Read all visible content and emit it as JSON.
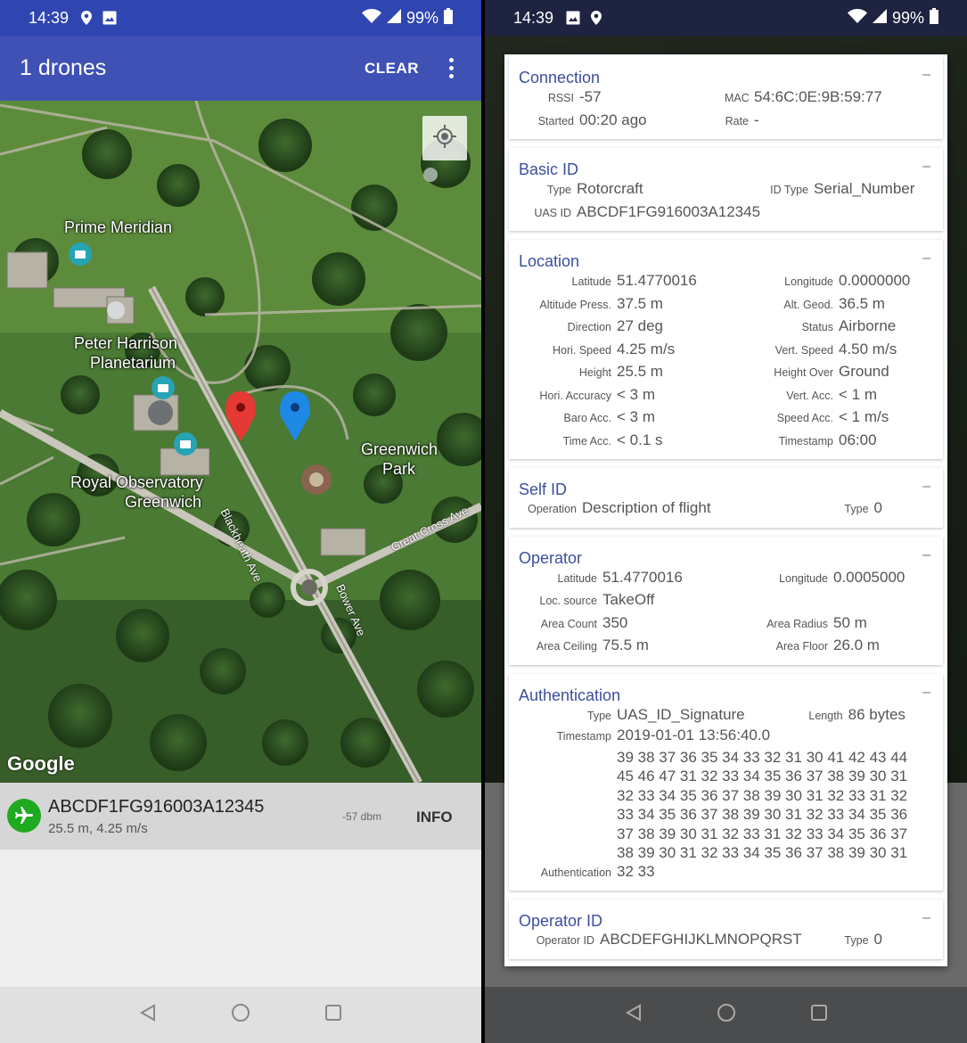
{
  "left": {
    "status": {
      "time": "14:39",
      "battery": "99%"
    },
    "appbar": {
      "title": "1 drones",
      "clear": "CLEAR"
    },
    "map": {
      "labels": {
        "prime_meridian": "Prime Meridian",
        "planetarium_1": "Peter Harrison",
        "planetarium_2": "Planetarium",
        "observatory_1": "Royal Observatory",
        "observatory_2": "Greenwich",
        "park_1": "Greenwich",
        "park_2": "Park",
        "blackheath": "Blackheath Ave",
        "bower": "Bower Ave",
        "great_cross": "Great Cross Ave"
      },
      "google": "Google"
    },
    "drone": {
      "id": "ABCDF1FG916003A12345",
      "sub": "25.5 m, 4.25 m/s",
      "rssi": "-57 dbm",
      "info": "INFO"
    }
  },
  "right": {
    "status": {
      "time": "14:39",
      "battery": "99%"
    },
    "collapse": "–",
    "connection": {
      "title": "Connection",
      "rssi_k": "RSSI",
      "rssi_v": "-57",
      "mac_k": "MAC",
      "mac_v": "54:6C:0E:9B:59:77",
      "started_k": "Started",
      "started_v": "00:20  ago",
      "rate_k": "Rate",
      "rate_v": "-"
    },
    "basic": {
      "title": "Basic ID",
      "type_k": "Type",
      "type_v": "Rotorcraft",
      "idtype_k": "ID Type",
      "idtype_v": "Serial_Number",
      "uasid_k": "UAS ID",
      "uasid_v": "ABCDF1FG916003A12345"
    },
    "location": {
      "title": "Location",
      "rows": [
        [
          "Latitude",
          "51.4770016",
          "Longitude",
          "0.0000000"
        ],
        [
          "Altitude Press.",
          "37.5 m",
          "Alt. Geod.",
          "36.5 m"
        ],
        [
          "Direction",
          " 27 deg",
          "Status",
          "Airborne"
        ],
        [
          "Hori. Speed",
          "4.25 m/s",
          "Vert. Speed",
          "4.50 m/s"
        ],
        [
          "Height",
          "25.5 m",
          "Height Over",
          "Ground"
        ],
        [
          "Hori. Accuracy",
          "< 3 m",
          "Vert. Acc.",
          "< 1 m"
        ],
        [
          "Baro Acc.",
          "< 3 m",
          "Speed Acc.",
          "< 1 m/s"
        ],
        [
          "Time Acc.",
          "< 0.1 s",
          "Timestamp",
          "06:00"
        ]
      ]
    },
    "selfid": {
      "title": "Self ID",
      "op_k": "Operation",
      "op_v": "Description of flight",
      "type_k": "Type",
      "type_v": "0"
    },
    "operator": {
      "title": "Operator",
      "rows": [
        [
          "Latitude",
          "51.4770016",
          "Longitude",
          "0.0005000"
        ],
        [
          "Loc. source",
          "TakeOff",
          "",
          ""
        ],
        [
          "Area Count",
          "350",
          "Area Radius",
          "50 m"
        ],
        [
          "Area Ceiling",
          "75.5 m",
          "Area Floor",
          "26.0 m"
        ]
      ]
    },
    "auth": {
      "title": "Authentication",
      "type_k": "Type",
      "type_v": "UAS_ID_Signature",
      "len_k": "Length",
      "len_v": "86 bytes",
      "ts_k": "Timestamp",
      "ts_v": "2019-01-01 13:56:40.0",
      "hex_lines": [
        "39 38 37 36 35 34 33 32 31 30 41 42 43 44",
        "45 46 47 31 32 33 34 35 36 37 38 39 30 31",
        "32 33 34 35 36 37 38 39 30 31 32 33 31 32",
        "33 34 35 36 37 38 39 30 31 32 33 34 35 36",
        "37 38 39 30 31 32 33 31 32 33 34 35 36 37",
        "38 39 30 31 32 33 34 35 36 37 38 39 30 31"
      ],
      "auth_k": "Authentication",
      "auth_v": "32 33"
    },
    "opid": {
      "title": "Operator ID",
      "k": "Operator ID",
      "v": "ABCDEFGHIJKLMNOPQRST",
      "type_k": "Type",
      "type_v": "0"
    }
  }
}
